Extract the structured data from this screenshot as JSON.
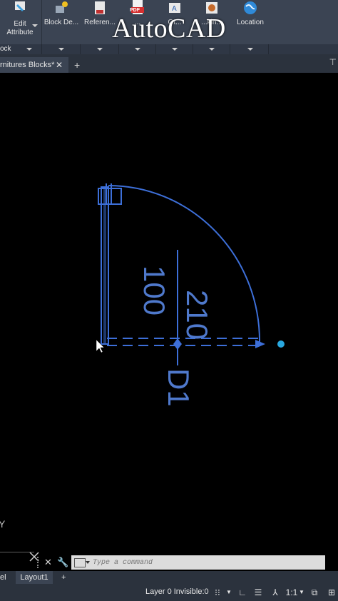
{
  "overlay_title": "AutoCAD",
  "ribbon": {
    "buttons": [
      {
        "label": "Edit Attribute",
        "icon": "edit-attribute-icon"
      },
      {
        "label": "Block De...",
        "icon": "block-definition-icon"
      },
      {
        "label": "Referen...",
        "icon": "reference-icon"
      },
      {
        "label": "...",
        "icon": "pdf-import-icon",
        "badge": "PDF"
      },
      {
        "label": "Ot...",
        "icon": "text-style-icon"
      },
      {
        "label": "...kin...",
        "icon": "markup-icon"
      },
      {
        "label": "Location",
        "icon": "globe-icon"
      }
    ],
    "panel_left_label": "ock"
  },
  "doc_tabs": {
    "active": "rnitures Blocks*",
    "close_glyph": "✕",
    "add_glyph": "+"
  },
  "drawing": {
    "dim_height": "210",
    "dim_width": "100",
    "tag": "D1",
    "ucs_axis": "Y",
    "stroke_color": "#3d6fd8",
    "text_color": "#4f79cc",
    "grip_color": "#29a8e0"
  },
  "command": {
    "placeholder": "Type a command"
  },
  "layout_tabs": [
    "el",
    "Layout1"
  ],
  "layout_add": "+",
  "status": {
    "layer": "Layer 0 Invisible:0",
    "scale": "1:1"
  }
}
